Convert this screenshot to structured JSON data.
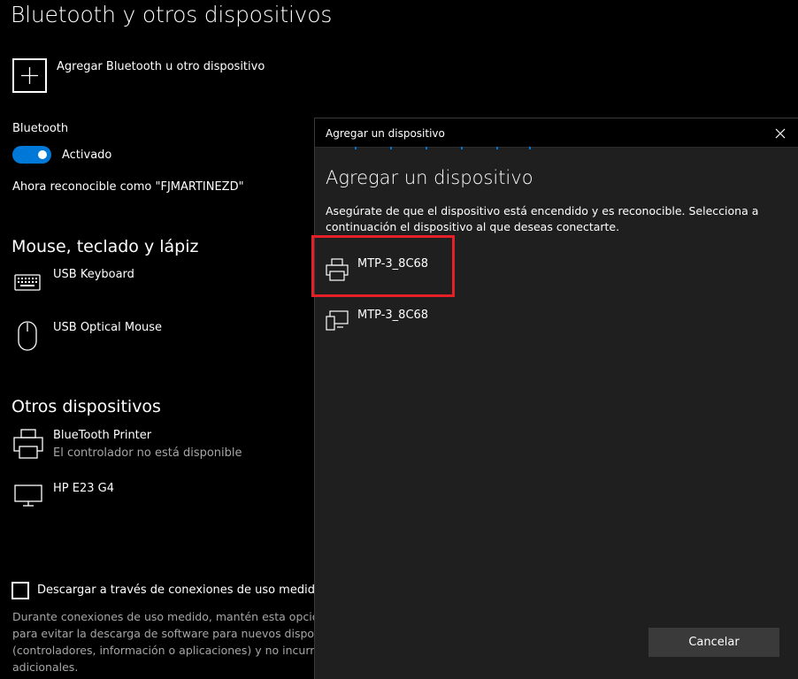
{
  "page": {
    "title": "Bluetooth y otros dispositivos",
    "add_device_label": "Agregar Bluetooth u otro dispositivo"
  },
  "bluetooth": {
    "label": "Bluetooth",
    "toggle_state": "Activado",
    "discoverable_text": "Ahora reconocible como \"FJMARTINEZD\""
  },
  "mouse_section": {
    "title": "Mouse, teclado y lápiz",
    "devices": [
      {
        "name": "USB Keyboard",
        "icon": "keyboard-icon"
      },
      {
        "name": "USB Optical Mouse",
        "icon": "mouse-icon"
      }
    ]
  },
  "other_section": {
    "title": "Otros dispositivos",
    "devices": [
      {
        "name": "BlueTooth Printer",
        "status": "El controlador no está disponible",
        "icon": "printer-icon"
      },
      {
        "name": "HP E23 G4",
        "icon": "monitor-icon"
      }
    ]
  },
  "metered": {
    "checkbox_label": "Descargar a través de conexiones de uso medido",
    "description_lines": [
      "Durante conexiones de uso medido, mantén esta opció",
      "para evitar la descarga de software para nuevos dispositi",
      "(controladores, información o aplicaciones) y no incurrir",
      "adicionales."
    ]
  },
  "dialog": {
    "titlebar": "Agregar un dispositivo",
    "heading": "Agregar un dispositivo",
    "description_lines": [
      "Asegúrate de que el dispositivo está encendido y es reconocible. Selecciona a",
      "continuación el dispositivo al que deseas conectarte."
    ],
    "devices": [
      {
        "name": "MTP-3_8C68",
        "icon": "printer-icon",
        "highlighted": true
      },
      {
        "name": "MTP-3_8C68",
        "icon": "device-icon",
        "highlighted": false
      }
    ],
    "cancel_label": "Cancelar"
  },
  "colors": {
    "accent": "#0078d7",
    "highlight": "#e51f28",
    "background": "#000000",
    "dialog_background": "#1f1f1f",
    "secondary_text": "#a6a6a6"
  }
}
